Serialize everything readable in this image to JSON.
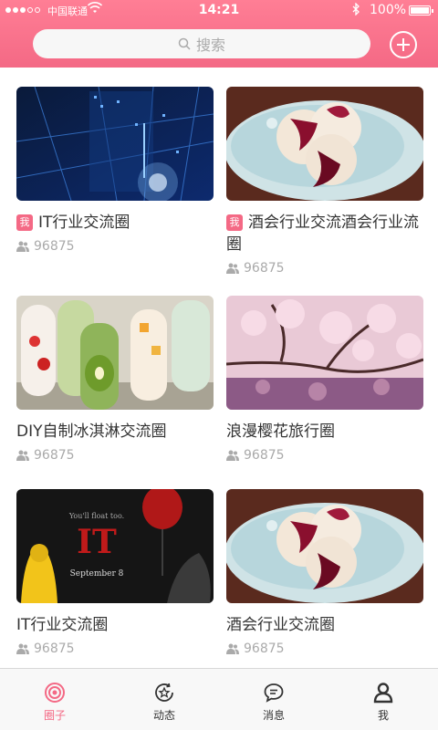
{
  "status_bar": {
    "carrier": "中国联通",
    "time": "14:21",
    "battery": "100%"
  },
  "search": {
    "placeholder": "搜索"
  },
  "circles": [
    {
      "title": "IT行业交流圈",
      "tag": "我",
      "members": "96875"
    },
    {
      "title": "酒会行业交流酒会行业流圈",
      "tag": "我",
      "members": "96875"
    },
    {
      "title": "DIY自制冰淇淋交流圈",
      "tag": "",
      "members": "96875"
    },
    {
      "title": "浪漫樱花旅行圈",
      "tag": "",
      "members": "96875"
    },
    {
      "title": "IT行业交流圈",
      "tag": "",
      "members": "96875"
    },
    {
      "title": "酒会行业交流圈",
      "tag": "",
      "members": "96875"
    }
  ],
  "poster": {
    "tagline": "You'll float too.",
    "title": "IT",
    "date": "September 8"
  },
  "tabs": [
    {
      "label": "圈子",
      "icon": "circle-target-icon",
      "active": true
    },
    {
      "label": "动态",
      "icon": "star-refresh-icon",
      "active": false
    },
    {
      "label": "消息",
      "icon": "chat-bubble-icon",
      "active": false
    },
    {
      "label": "我",
      "icon": "user-icon",
      "active": false
    }
  ],
  "colors": {
    "accent": "#f46985",
    "header_top": "#ff7e95"
  }
}
